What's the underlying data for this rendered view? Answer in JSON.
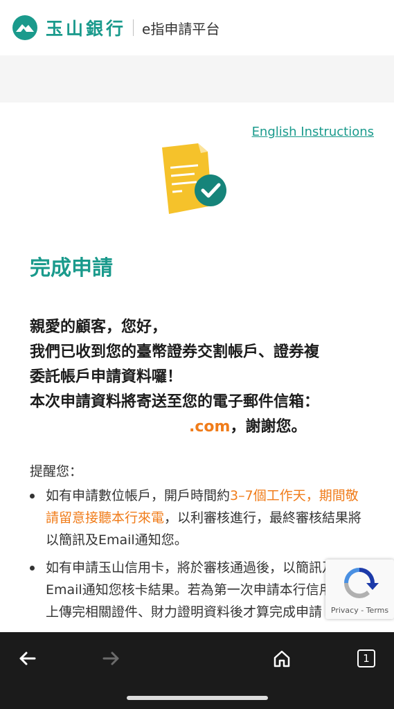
{
  "header": {
    "bank_name": "玉山銀行",
    "platform": "e指申請平台"
  },
  "links": {
    "english": "English Instructions"
  },
  "main": {
    "title": "完成申請",
    "greeting_lines": [
      "親愛的顧客，您好，",
      "我們已收到您的臺幣證券交割帳戶、證券複",
      "委託帳戶申請資料囉！",
      "本次申請資料將寄送至您的電子郵件信箱："
    ],
    "email_domain": ".com",
    "thanks": "，謝謝您。"
  },
  "reminder": {
    "heading": "提醒您：",
    "item1": {
      "part1": "如有申請數位帳戶，開戶時間約",
      "highlight": "3–7個工作天，期間敬請留意接聽本行來電",
      "part2": "，以利審核進行，最終審核結果將以簡訊及Email通知您。"
    },
    "item2": {
      "text": "如有申請玉山信用卡，將於審核通過後，以簡訊及Email通知您核卡結果。若為第一次申請本行信用卡，上傳完相關證件、財力證明資料後才算完成申請"
    }
  },
  "recaptcha": {
    "label": "Privacy - Terms"
  },
  "navbar": {
    "tab_count": "1",
    "back_icon": "arrow-left-icon",
    "forward_icon": "arrow-right-icon",
    "home_icon": "home-icon"
  },
  "colors": {
    "brand": "#1a9a8c",
    "accent": "#f07c1a",
    "doc_yellow": "#f5c22b"
  }
}
